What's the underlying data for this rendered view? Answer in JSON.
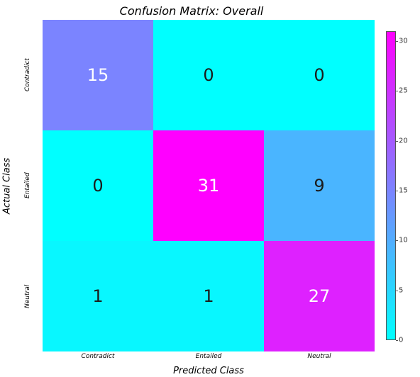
{
  "chart_data": {
    "type": "heatmap",
    "title": "Confusion Matrix: Overall",
    "xlabel": "Predicted Class",
    "ylabel": "Actual Class",
    "x_categories": [
      "Contradict",
      "Entailed",
      "Neutral"
    ],
    "y_categories": [
      "Contradict",
      "Entailed",
      "Neutral"
    ],
    "matrix": [
      [
        15,
        0,
        0
      ],
      [
        0,
        31,
        9
      ],
      [
        1,
        1,
        27
      ]
    ],
    "vmin": 0,
    "vmax": 31,
    "colorbar_ticks": [
      0,
      5,
      10,
      15,
      20,
      25,
      30
    ],
    "cmap": "cool"
  }
}
